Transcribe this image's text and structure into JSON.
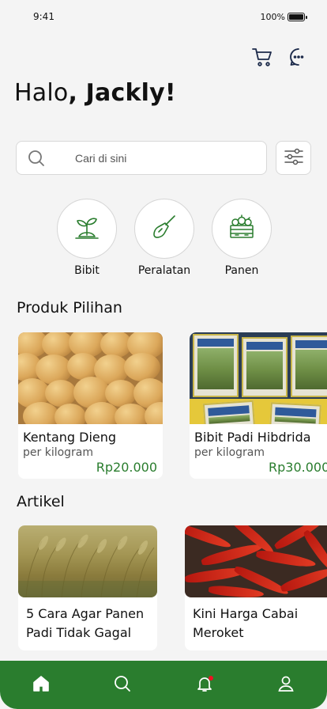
{
  "status": {
    "time": "9:41",
    "battery": "100%",
    "battery_level": 1.0
  },
  "header": {
    "greeting_prefix": "Halo",
    "greeting_name": ", Jackly!"
  },
  "search": {
    "placeholder": "Cari di sini"
  },
  "categories": [
    {
      "label": "Bibit",
      "icon": "sprout-icon"
    },
    {
      "label": "Peralatan",
      "icon": "trowel-icon"
    },
    {
      "label": "Panen",
      "icon": "harvest-crate-icon"
    }
  ],
  "products_section": {
    "title": "Produk Pilihan",
    "items": [
      {
        "name": "Kentang Dieng",
        "unit": "per kilogram",
        "price": "Rp20.000",
        "image": "potatoes"
      },
      {
        "name": "Bibit Padi Hibdrida",
        "unit": "per kilogram",
        "price": "Rp30.000",
        "image": "rice-seed-bags"
      }
    ]
  },
  "articles_section": {
    "title": "Artikel",
    "items": [
      {
        "title": "5 Cara Agar Panen Padi Tidak Gagal",
        "image": "rice-field"
      },
      {
        "title": "Kini Harga Cabai Meroket",
        "image": "red-chili"
      }
    ]
  },
  "bottom_nav": [
    {
      "icon": "home-icon",
      "active": true
    },
    {
      "icon": "search-icon",
      "active": false
    },
    {
      "icon": "bell-icon",
      "active": false,
      "has_notification": true
    },
    {
      "icon": "profile-icon",
      "active": false
    }
  ],
  "colors": {
    "accent": "#2a7d2e",
    "background": "#f4f4f4",
    "price": "#2a7d2e",
    "notification": "#ee1122"
  }
}
